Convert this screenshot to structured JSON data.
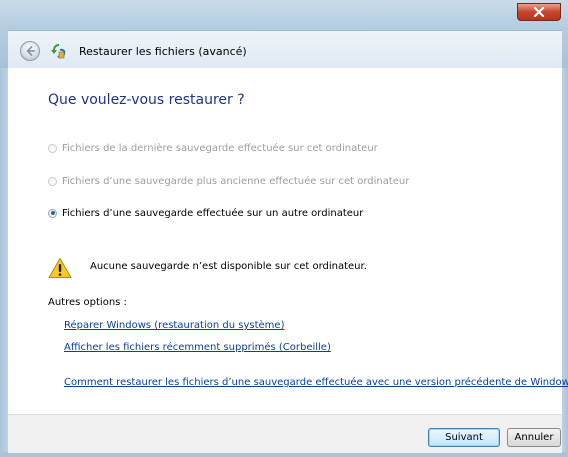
{
  "window": {
    "title": "Restaurer les fichiers (avancé)"
  },
  "main": {
    "heading": "Que voulez-vous restaurer ?",
    "options": [
      {
        "label": "Fichiers de la dernière sauvegarde effectuée sur cet ordinateur",
        "enabled": false,
        "selected": false
      },
      {
        "label": "Fichiers d’une sauvegarde plus ancienne effectuée sur cet ordinateur",
        "enabled": false,
        "selected": false
      },
      {
        "label": "Fichiers d’une sauvegarde effectuée sur un autre ordinateur",
        "enabled": true,
        "selected": true
      }
    ],
    "warning": {
      "icon": "warning-icon",
      "text": "Aucune sauvegarde n’est disponible sur cet ordinateur."
    },
    "other_options_label": "Autres options :",
    "links": [
      "Réparer Windows (restauration du système)",
      "Afficher les fichiers récemment supprimés (Corbeille)",
      "Comment restaurer les fichiers d’une sauvegarde effectuée avec une version précédente de Windows ?"
    ]
  },
  "footer": {
    "next_label": "Suivant",
    "cancel_label": "Annuler"
  },
  "colors": {
    "heading": "#1e3287",
    "link": "#0b3f9b",
    "disabled_text": "#9d9d9d"
  }
}
